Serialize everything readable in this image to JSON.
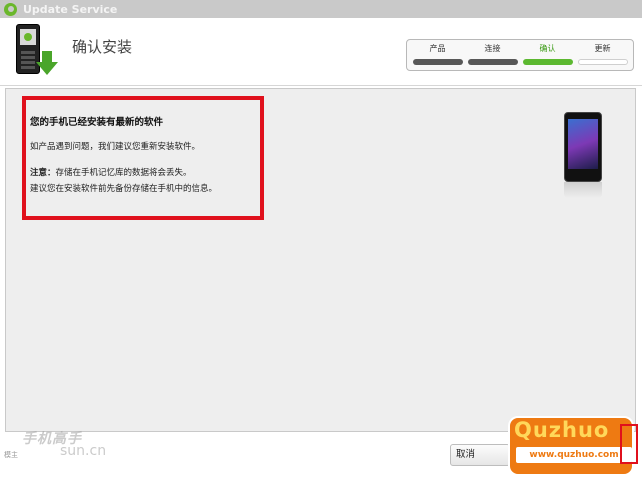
{
  "window": {
    "title": "Update Service"
  },
  "header": {
    "title": "确认安装"
  },
  "steps": [
    {
      "label": "产品",
      "state": "done"
    },
    {
      "label": "连接",
      "state": "done"
    },
    {
      "label": "确认",
      "state": "active"
    },
    {
      "label": "更新",
      "state": "pending"
    }
  ],
  "message": {
    "title": "您的手机已经安装有最新的软件",
    "line1": "如产品遇到问题，我们建议您重新安装软件。",
    "note_label": "注意：",
    "note_text": "存储在手机记忆库的数据将会丢失。",
    "line3": "建议您在安装软件前先备份存储在手机中的信息。"
  },
  "footer": {
    "cancel_label": "取消"
  },
  "watermark": {
    "left_text": "手机高手",
    "left_url": "sun.cn",
    "small_text": "模主",
    "brand": "Quzhuo",
    "url": "www.quzhuo.com"
  },
  "colors": {
    "accent": "#5cb830",
    "highlight": "#e0101c",
    "watermark": "#ee7a12"
  },
  "icons": {
    "app": "sony-ericsson-logo-icon",
    "header": "phone-download-icon",
    "device": "smartphone-icon"
  }
}
